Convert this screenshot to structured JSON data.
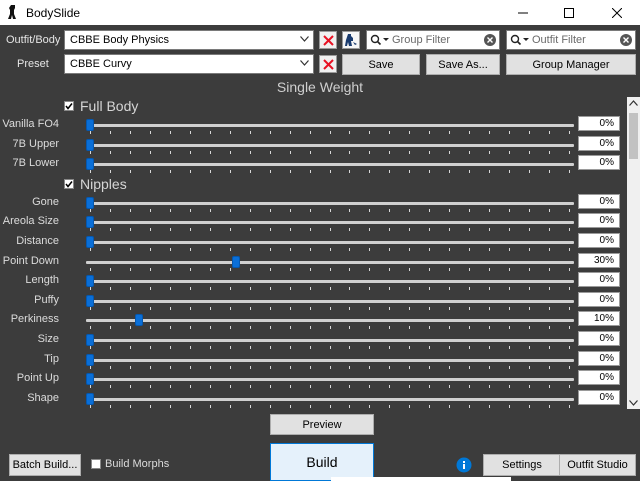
{
  "window": {
    "title": "BodySlide",
    "app_icon": "bodyslide-figure-icon",
    "controls": [
      "minimize-icon",
      "maximize-icon",
      "close-icon"
    ]
  },
  "outfit": {
    "label": "Outfit/Body",
    "value": "CBBE Body Physics"
  },
  "preset": {
    "label": "Preset",
    "value": "CBBE Curvy"
  },
  "filters": {
    "group_placeholder": "Group Filter",
    "outfit_placeholder": "Outfit Filter"
  },
  "buttons": {
    "save": "Save",
    "save_as": "Save As...",
    "group_manager": "Group Manager",
    "preview": "Preview",
    "build": "Build",
    "batch_build": "Batch Build...",
    "settings": "Settings",
    "outfit_studio": "Outfit Studio"
  },
  "build_morphs": {
    "label": "Build Morphs",
    "checked": false
  },
  "weight_heading": "Single Weight",
  "categories": [
    {
      "name": "Full Body",
      "checked": true,
      "sliders": [
        {
          "name": "Vanilla FO4",
          "value": "0%",
          "percent": 0
        },
        {
          "name": "7B Upper",
          "value": "0%",
          "percent": 0
        },
        {
          "name": "7B Lower",
          "value": "0%",
          "percent": 0
        }
      ]
    },
    {
      "name": "Nipples",
      "checked": true,
      "sliders": [
        {
          "name": "Gone",
          "value": "0%",
          "percent": 0
        },
        {
          "name": "Areola Size",
          "value": "0%",
          "percent": 0
        },
        {
          "name": "Distance",
          "value": "0%",
          "percent": 0
        },
        {
          "name": "Point Down",
          "value": "30%",
          "percent": 30
        },
        {
          "name": "Length",
          "value": "0%",
          "percent": 0
        },
        {
          "name": "Puffy",
          "value": "0%",
          "percent": 0
        },
        {
          "name": "Perkiness",
          "value": "10%",
          "percent": 10
        },
        {
          "name": "Size",
          "value": "0%",
          "percent": 0
        },
        {
          "name": "Tip",
          "value": "0%",
          "percent": 0
        },
        {
          "name": "Point Up",
          "value": "0%",
          "percent": 0
        },
        {
          "name": "Shape",
          "value": "0%",
          "percent": 0
        }
      ]
    }
  ],
  "colors": {
    "background": "#3c3c3c",
    "slider_thumb": "#0a6fd8",
    "remove_x": "#e81123",
    "info": "#0078d7"
  }
}
